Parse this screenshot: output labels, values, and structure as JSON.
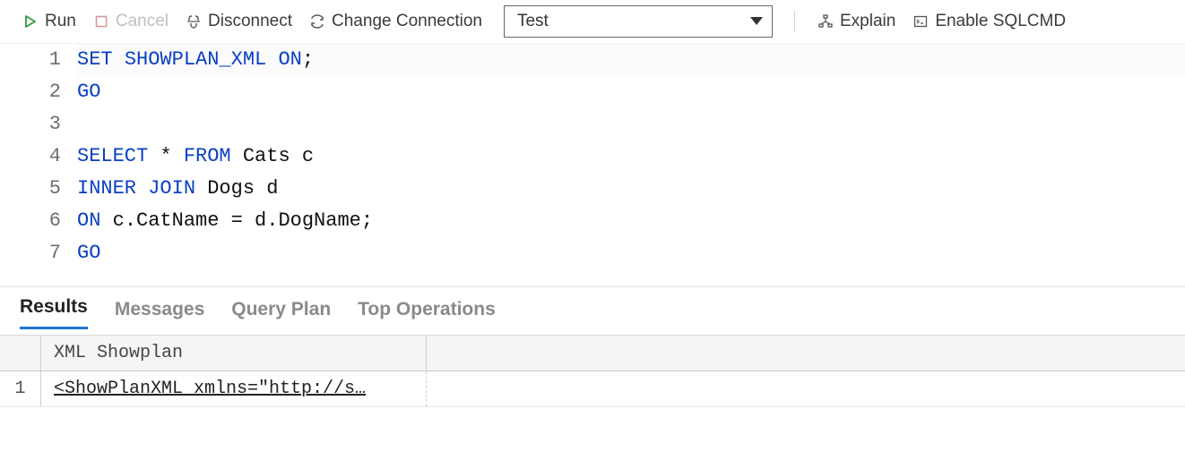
{
  "toolbar": {
    "run_label": "Run",
    "cancel_label": "Cancel",
    "disconnect_label": "Disconnect",
    "change_conn_label": "Change Connection",
    "explain_label": "Explain",
    "sqlcmd_label": "Enable SQLCMD",
    "database_selected": "Test"
  },
  "editor": {
    "lines": [
      {
        "n": "1",
        "tokens": [
          [
            "kw",
            "SET"
          ],
          [
            "sp",
            " "
          ],
          [
            "kw",
            "SHOWPLAN_XML"
          ],
          [
            "sp",
            " "
          ],
          [
            "kw",
            "ON"
          ],
          [
            "op",
            ";"
          ]
        ]
      },
      {
        "n": "2",
        "tokens": [
          [
            "cmd",
            "GO"
          ]
        ]
      },
      {
        "n": "3",
        "tokens": []
      },
      {
        "n": "4",
        "tokens": [
          [
            "kw",
            "SELECT"
          ],
          [
            "sp",
            " "
          ],
          [
            "op",
            "*"
          ],
          [
            "sp",
            " "
          ],
          [
            "kw",
            "FROM"
          ],
          [
            "sp",
            " "
          ],
          [
            "id",
            "Cats"
          ],
          [
            "sp",
            " "
          ],
          [
            "id",
            "c"
          ]
        ]
      },
      {
        "n": "5",
        "tokens": [
          [
            "kw",
            "INNER"
          ],
          [
            "sp",
            " "
          ],
          [
            "kw",
            "JOIN"
          ],
          [
            "sp",
            " "
          ],
          [
            "id",
            "Dogs"
          ],
          [
            "sp",
            " "
          ],
          [
            "id",
            "d"
          ]
        ]
      },
      {
        "n": "6",
        "tokens": [
          [
            "kw",
            "ON"
          ],
          [
            "sp",
            " "
          ],
          [
            "id",
            "c"
          ],
          [
            "op",
            "."
          ],
          [
            "id",
            "CatName"
          ],
          [
            "sp",
            " "
          ],
          [
            "op",
            "="
          ],
          [
            "sp",
            " "
          ],
          [
            "id",
            "d"
          ],
          [
            "op",
            "."
          ],
          [
            "id",
            "DogName"
          ],
          [
            "op",
            ";"
          ]
        ]
      },
      {
        "n": "7",
        "tokens": [
          [
            "cmd",
            "GO"
          ]
        ]
      }
    ]
  },
  "results": {
    "tabs": [
      "Results",
      "Messages",
      "Query Plan",
      "Top Operations"
    ],
    "active_tab": "Results",
    "column_header": "XML Showplan",
    "rows": [
      {
        "num": "1",
        "value": "<ShowPlanXML xmlns=\"http://s…"
      }
    ]
  }
}
